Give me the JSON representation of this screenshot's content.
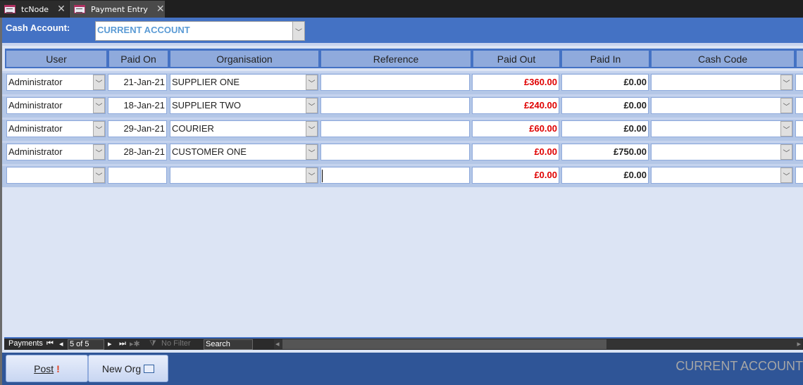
{
  "tabs": [
    {
      "label": "tcNode",
      "icon": "form-icon",
      "active": false
    },
    {
      "label": "Payment Entry",
      "icon": "form-icon",
      "active": true
    }
  ],
  "header": {
    "cash_account_label": "Cash Account:",
    "cash_account_value": "CURRENT ACCOUNT"
  },
  "columns": [
    "User",
    "Paid On",
    "Organisation",
    "Reference",
    "Paid Out",
    "Paid In",
    "Cash Code"
  ],
  "rows": [
    {
      "user": "Administrator",
      "paid_on": "21-Jan-21",
      "organisation": "SUPPLIER ONE",
      "reference": "",
      "paid_out": "£360.00",
      "paid_in": "£0.00",
      "cash_code": ""
    },
    {
      "user": "Administrator",
      "paid_on": "18-Jan-21",
      "organisation": "SUPPLIER TWO",
      "reference": "",
      "paid_out": "£240.00",
      "paid_in": "£0.00",
      "cash_code": ""
    },
    {
      "user": "Administrator",
      "paid_on": "29-Jan-21",
      "organisation": "COURIER",
      "reference": "",
      "paid_out": "£60.00",
      "paid_in": "£0.00",
      "cash_code": ""
    },
    {
      "user": "Administrator",
      "paid_on": "28-Jan-21",
      "organisation": "CUSTOMER ONE",
      "reference": "",
      "paid_out": "£0.00",
      "paid_in": "£750.00",
      "cash_code": ""
    },
    {
      "user": "",
      "paid_on": "",
      "organisation": "",
      "reference": "",
      "paid_out": "£0.00",
      "paid_in": "£0.00",
      "cash_code": ""
    }
  ],
  "navigation": {
    "label": "Payments",
    "record": "5 of 5",
    "filter": "No Filter",
    "search": "Search"
  },
  "footer": {
    "post_label": "Post",
    "new_org_label": "New Org",
    "account_label": "CURRENT ACCOUNT"
  },
  "colors": {
    "header": "#4472c4",
    "footer": "#2f5597",
    "negative": "#e00000"
  }
}
